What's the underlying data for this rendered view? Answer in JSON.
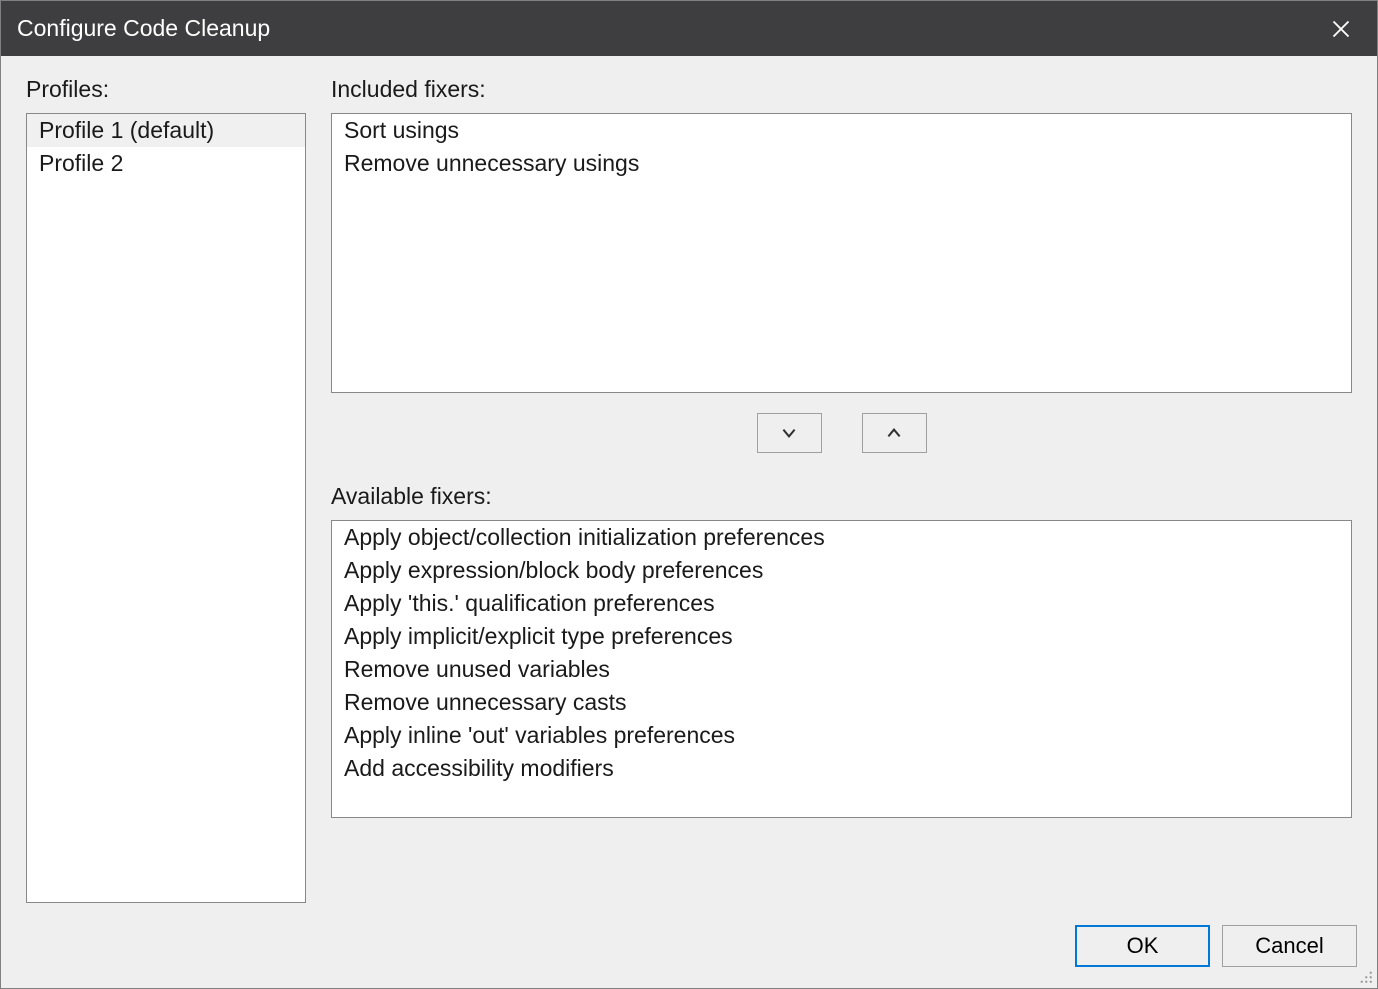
{
  "titlebar": {
    "title": "Configure Code Cleanup"
  },
  "labels": {
    "profiles": "Profiles:",
    "included_fixers": "Included fixers:",
    "available_fixers": "Available fixers:"
  },
  "profiles": {
    "items": [
      {
        "label": "Profile 1 (default)",
        "selected": true
      },
      {
        "label": "Profile 2",
        "selected": false
      }
    ]
  },
  "included_fixers": {
    "items": [
      "Sort usings",
      "Remove unnecessary usings"
    ]
  },
  "available_fixers": {
    "items": [
      "Apply object/collection initialization preferences",
      "Apply expression/block body preferences",
      "Apply 'this.' qualification preferences",
      "Apply implicit/explicit type preferences",
      "Remove unused variables",
      "Remove unnecessary casts",
      "Apply inline 'out' variables preferences",
      "Add accessibility modifiers"
    ]
  },
  "buttons": {
    "ok": "OK",
    "cancel": "Cancel"
  }
}
